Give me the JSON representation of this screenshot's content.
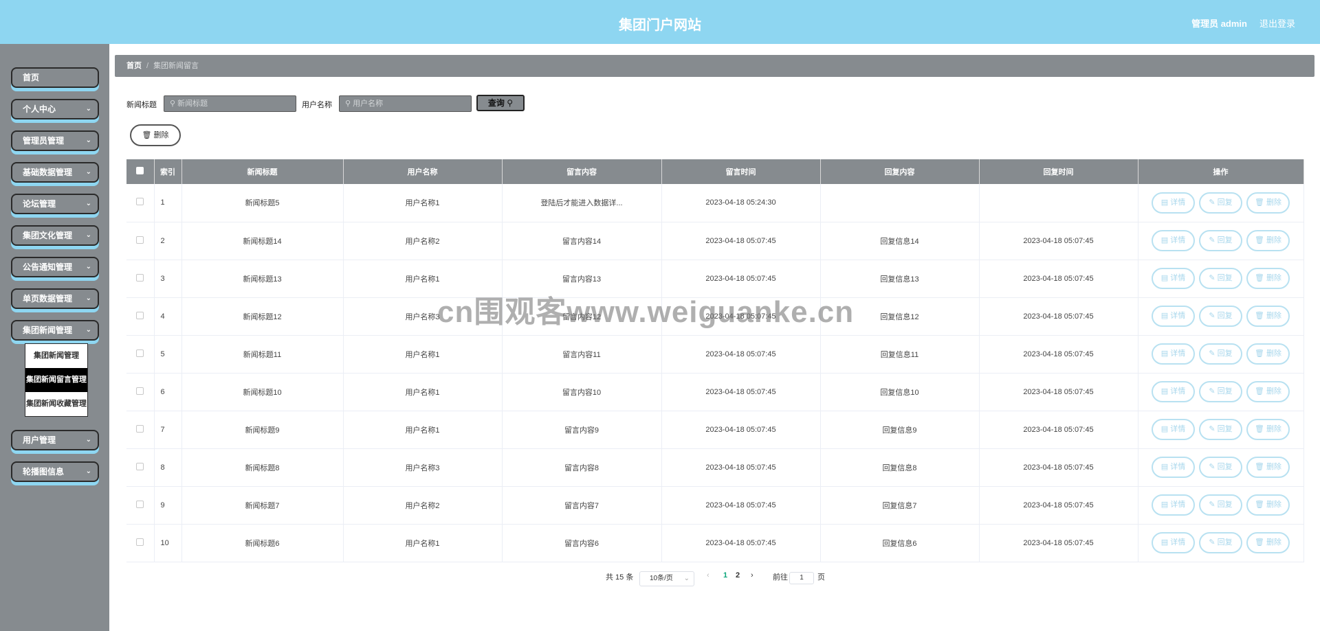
{
  "header": {
    "title": "集团门户网站",
    "admin": "管理员 admin",
    "logout": "退出登录"
  },
  "sidebar": {
    "items": [
      {
        "label": "首页",
        "chevron": ""
      },
      {
        "label": "个人中心",
        "chevron": "⌄"
      },
      {
        "label": "管理员管理",
        "chevron": "⌄"
      },
      {
        "label": "基础数据管理",
        "chevron": "⌄"
      },
      {
        "label": "论坛管理",
        "chevron": "⌄"
      },
      {
        "label": "集团文化管理",
        "chevron": "⌄"
      },
      {
        "label": "公告通知管理",
        "chevron": "⌄"
      },
      {
        "label": "单页数据管理",
        "chevron": "⌄"
      },
      {
        "label": "集团新闻管理",
        "chevron": "⌄"
      },
      {
        "label": "用户管理",
        "chevron": "⌄"
      },
      {
        "label": "轮播图信息",
        "chevron": "⌄"
      }
    ],
    "submenu": [
      "集团新闻管理",
      "集团新闻留言管理",
      "集团新闻收藏管理"
    ]
  },
  "breadcrumb": {
    "home": "首页",
    "sep": "/",
    "current": "集团新闻留言"
  },
  "search": {
    "title_label": "新闻标题",
    "title_placeholder": "新闻标题",
    "user_label": "用户名称",
    "user_placeholder": "用户名称",
    "button": "查询"
  },
  "delete_button": "删除",
  "table": {
    "headers": [
      "索引",
      "新闻标题",
      "用户名称",
      "留言内容",
      "留言时间",
      "回复内容",
      "回复时间",
      "操作"
    ],
    "rows": [
      [
        "1",
        "新闻标题5",
        "用户名称1",
        "登陆后才能进入数据详...",
        "2023-04-18 05:24:30",
        "",
        ""
      ],
      [
        "2",
        "新闻标题14",
        "用户名称2",
        "留言内容14",
        "2023-04-18 05:07:45",
        "回复信息14",
        "2023-04-18 05:07:45"
      ],
      [
        "3",
        "新闻标题13",
        "用户名称1",
        "留言内容13",
        "2023-04-18 05:07:45",
        "回复信息13",
        "2023-04-18 05:07:45"
      ],
      [
        "4",
        "新闻标题12",
        "用户名称3",
        "留言内容12",
        "2023-04-18 05:07:45",
        "回复信息12",
        "2023-04-18 05:07:45"
      ],
      [
        "5",
        "新闻标题11",
        "用户名称1",
        "留言内容11",
        "2023-04-18 05:07:45",
        "回复信息11",
        "2023-04-18 05:07:45"
      ],
      [
        "6",
        "新闻标题10",
        "用户名称1",
        "留言内容10",
        "2023-04-18 05:07:45",
        "回复信息10",
        "2023-04-18 05:07:45"
      ],
      [
        "7",
        "新闻标题9",
        "用户名称1",
        "留言内容9",
        "2023-04-18 05:07:45",
        "回复信息9",
        "2023-04-18 05:07:45"
      ],
      [
        "8",
        "新闻标题8",
        "用户名称3",
        "留言内容8",
        "2023-04-18 05:07:45",
        "回复信息8",
        "2023-04-18 05:07:45"
      ],
      [
        "9",
        "新闻标题7",
        "用户名称2",
        "留言内容7",
        "2023-04-18 05:07:45",
        "回复信息7",
        "2023-04-18 05:07:45"
      ],
      [
        "10",
        "新闻标题6",
        "用户名称1",
        "留言内容6",
        "2023-04-18 05:07:45",
        "回复信息6",
        "2023-04-18 05:07:45"
      ]
    ],
    "actions": [
      "详情",
      "回复",
      "删除"
    ]
  },
  "pagination": {
    "total": "共 15 条",
    "page_size": "10条/页",
    "pages": [
      "1",
      "2"
    ],
    "goto_label": "前往",
    "goto_value": "1",
    "page_suffix": "页"
  },
  "watermark": "cn围观客www.weiguanke.cn",
  "colors": {
    "header": "#8ed6f1",
    "sidebar": "#868b8f",
    "accent_text": "#0aa57a",
    "op_border": "#b8e1f1"
  }
}
